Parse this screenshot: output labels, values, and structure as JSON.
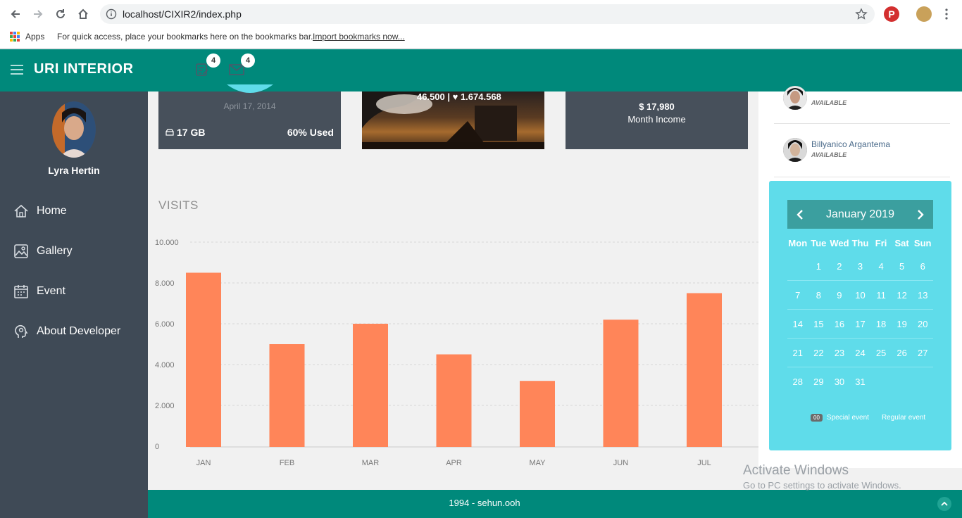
{
  "browser": {
    "url": "localhost/CIXIR2/index.php",
    "bookmarks": {
      "apps_label": "Apps",
      "hint": "For quick access, place your bookmarks here on the bookmarks bar.",
      "import_link": "Import bookmarks now..."
    }
  },
  "header": {
    "brand": "URI INTERIOR",
    "tasks_badge": "4",
    "mail_badge": "4"
  },
  "sidebar": {
    "user_name": "Lyra Hertin",
    "items": [
      {
        "label": "Home",
        "icon": "home-icon"
      },
      {
        "label": "Gallery",
        "icon": "gallery-icon"
      },
      {
        "label": "Event",
        "icon": "calendar-icon"
      },
      {
        "label": "About Developer",
        "icon": "developer-icon"
      }
    ]
  },
  "cards": {
    "date": "April 17, 2014",
    "storage": "17 GB",
    "used": "60% Used",
    "photo_stats": "46.500 | ♥ 1.674.568",
    "income": "$ 17,980",
    "income_label": "Month Income"
  },
  "visits": {
    "title": "VISITS"
  },
  "chart_data": {
    "type": "bar",
    "categories": [
      "JAN",
      "FEB",
      "MAR",
      "APR",
      "MAY",
      "JUN",
      "JUL"
    ],
    "values": [
      8500,
      5000,
      6000,
      4500,
      3200,
      6200,
      7500
    ],
    "ylim": [
      0,
      10000
    ],
    "yticks": [
      "0",
      "2.000",
      "4.000",
      "6.000",
      "8.000",
      "10.000"
    ],
    "grid": true,
    "bar_color": "#ff8559"
  },
  "contacts": [
    {
      "name": "",
      "status": "AVAILABLE"
    },
    {
      "name": "Billyanico Argantema",
      "status": "AVAILABLE"
    }
  ],
  "calendar": {
    "title": "January 2019",
    "days_of_week": [
      "Mon",
      "Tue",
      "Wed",
      "Thu",
      "Fri",
      "Sat",
      "Sun"
    ],
    "weeks": [
      [
        "",
        "1",
        "2",
        "3",
        "4",
        "5",
        "6"
      ],
      [
        "7",
        "8",
        "9",
        "10",
        "11",
        "12",
        "13"
      ],
      [
        "14",
        "15",
        "16",
        "17",
        "18",
        "19",
        "20"
      ],
      [
        "21",
        "22",
        "23",
        "24",
        "25",
        "26",
        "27"
      ],
      [
        "28",
        "29",
        "30",
        "31",
        "",
        "",
        ""
      ]
    ],
    "legend_badge": "00",
    "legend_special": "Special event",
    "legend_regular": "Regular event"
  },
  "footer": {
    "text": "1994 - sehun.ooh"
  },
  "watermark": {
    "title": "Activate Windows",
    "subtitle": "Go to PC settings to activate Windows."
  },
  "colors": {
    "teal": "#00897b",
    "sidebar": "#3f4a56",
    "calendar": "#5fdcea",
    "bar": "#ff8559"
  }
}
